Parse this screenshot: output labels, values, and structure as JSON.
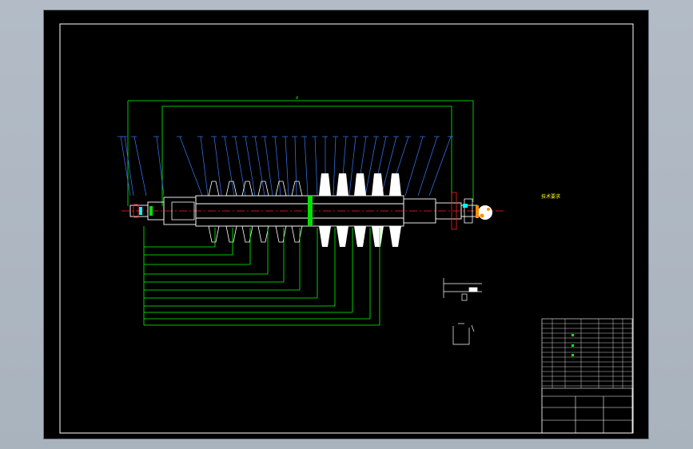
{
  "window": {
    "background": "#b0b9c3",
    "canvas": "#000000"
  },
  "colors": {
    "frame": "#ffffff",
    "shaft": "#ffffff",
    "dimension": "#00ff00",
    "leader": "#3a7bff",
    "centerline": "#ff2020",
    "notes": "#ffff00",
    "accent_green": "#00e000",
    "cyan": "#00ffff",
    "orange": "#ff8c00"
  },
  "technical_requirements": {
    "title": "技术要求",
    "items": [
      "",
      "",
      "",
      "",
      "",
      ""
    ]
  },
  "title_block": {
    "name": "",
    "drawing_no": ""
  }
}
